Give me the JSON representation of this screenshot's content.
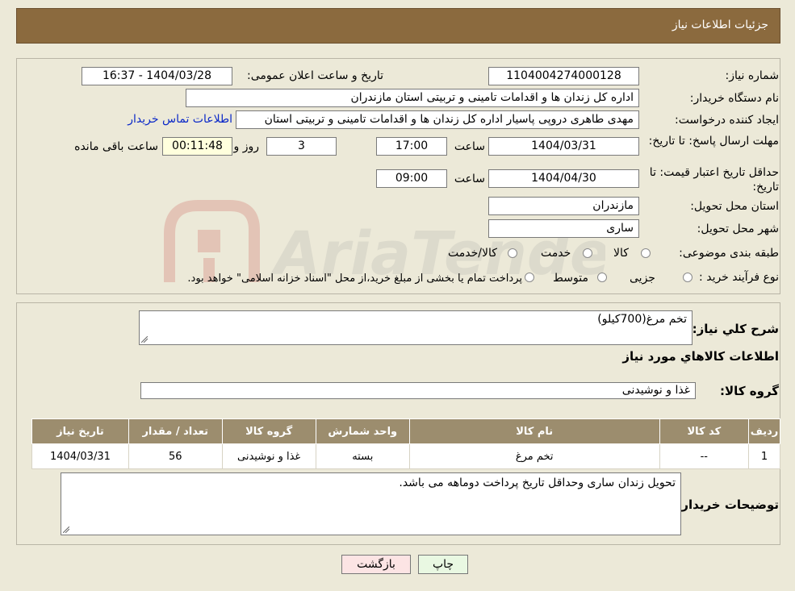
{
  "header": {
    "title": "جزئیات اطلاعات نیاز"
  },
  "fields": {
    "need_number_label": "شماره نیاز:",
    "need_number": "1104004274000128",
    "announce_datetime_label": "تاریخ و ساعت اعلان عمومی:",
    "announce_datetime": "1404/03/28 - 16:37",
    "buyer_org_label": "نام دستگاه خریدار:",
    "buyer_org": "اداره کل زندان ها و اقدامات تامینی و تربیتی استان مازندران",
    "requester_label": "ایجاد کننده درخواست:",
    "requester": "مهدی طاهری دروپی پاسیار اداره کل زندان ها و اقدامات تامینی و تربیتی استان",
    "buyer_contact_link": "اطلاعات تماس خریدار",
    "reply_deadline_label": "مهلت ارسال پاسخ: تا تاریخ:",
    "reply_deadline_date": "1404/03/31",
    "time_label": "ساعت",
    "reply_deadline_time": "17:00",
    "days_remaining": "3",
    "days_label": "روز و",
    "time_remaining": "00:11:48",
    "time_remaining_label": "ساعت باقی مانده",
    "price_validity_label": "حداقل تاریخ اعتبار قیمت: تا تاریخ:",
    "price_validity_date": "1404/04/30",
    "price_validity_time": "09:00",
    "delivery_province_label": "استان محل تحویل:",
    "delivery_province": "مازندران",
    "delivery_city_label": "شهر محل تحویل:",
    "delivery_city": "ساری",
    "category_label": "طبقه بندی موضوعی:",
    "category_options": [
      "کالا",
      "خدمت",
      "کالا/خدمت"
    ],
    "purchase_type_label": "نوع فرآیند خرید :",
    "purchase_type_options": [
      "جزیی",
      "متوسط"
    ],
    "purchase_note": "پرداخت تمام یا بخشی از مبلغ خرید،از محل \"اسناد خزانه اسلامی\" خواهد بود."
  },
  "details": {
    "description_label": "شرح کلي نياز:",
    "description": "تخم مرغ(700کیلو)",
    "goods_info_heading": "اطلاعات کالاهاي مورد نياز",
    "goods_group_label": "گروه کالا:",
    "goods_group": "غذا و نوشیدنی",
    "table": {
      "headers": [
        "رديف",
        "کد کالا",
        "نام کالا",
        "واحد شمارش",
        "گروه کالا",
        "تعداد / مقدار",
        "تاریخ نیاز"
      ],
      "rows": [
        [
          "1",
          "--",
          "تخم مرغ",
          "بسته",
          "غذا و نوشیدنی",
          "56",
          "1404/03/31"
        ]
      ]
    },
    "buyer_notes_label": "توضیحات خریدار:",
    "buyer_notes": "تحویل زندان ساری وحداقل تاریخ پرداخت دوماهه می باشد."
  },
  "buttons": {
    "print": "چاپ",
    "back": "بازگشت"
  },
  "watermark": {
    "text": "AriaTender.neT"
  },
  "colors": {
    "header_bg": "#8B6A3E",
    "table_header_bg": "#9C8D6E",
    "link": "#0a28c8",
    "back_button_bg": "#FCE4E4",
    "print_button_bg": "#E9F8E2"
  }
}
